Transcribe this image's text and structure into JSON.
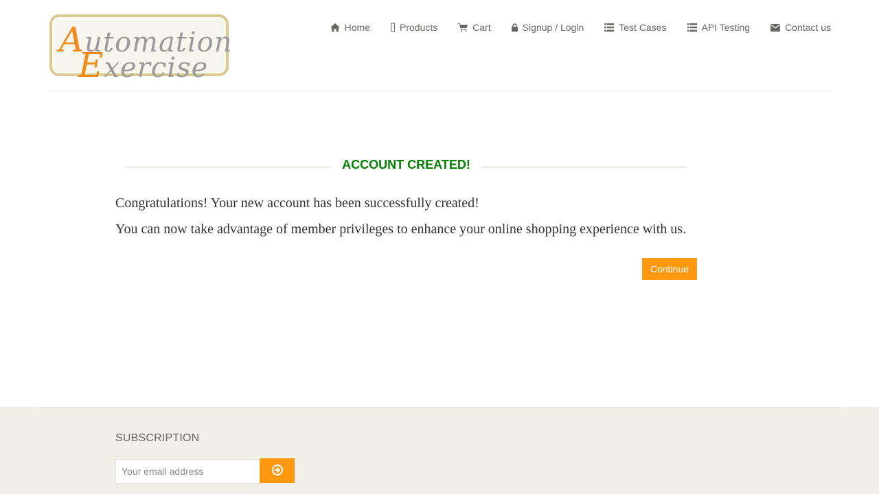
{
  "header": {
    "logo": {
      "line1": "Automation",
      "line2": "Exercise"
    },
    "nav": [
      {
        "label": "Home",
        "icon": "home-icon"
      },
      {
        "label": "Products",
        "icon": "products-icon"
      },
      {
        "label": "Cart",
        "icon": "cart-icon"
      },
      {
        "label": "Signup / Login",
        "icon": "lock-icon"
      },
      {
        "label": "Test Cases",
        "icon": "list-icon"
      },
      {
        "label": "API Testing",
        "icon": "list-icon"
      },
      {
        "label": "Contact us",
        "icon": "envelope-icon"
      }
    ]
  },
  "main": {
    "title": "ACCOUNT CREATED!",
    "message1": "Congratulations! Your new account has been successfully created!",
    "message2": "You can now take advantage of member privileges to enhance your online shopping experience with us.",
    "continue_label": "Continue"
  },
  "footer": {
    "subscription_title": "SUBSCRIPTION",
    "email_placeholder": "Your email address",
    "subscribe_icon": "arrow-circle-right-icon"
  },
  "colors": {
    "accent": "#fe980f",
    "success": "#008000",
    "text": "#696763",
    "footer_bg": "#f0f0e9"
  }
}
